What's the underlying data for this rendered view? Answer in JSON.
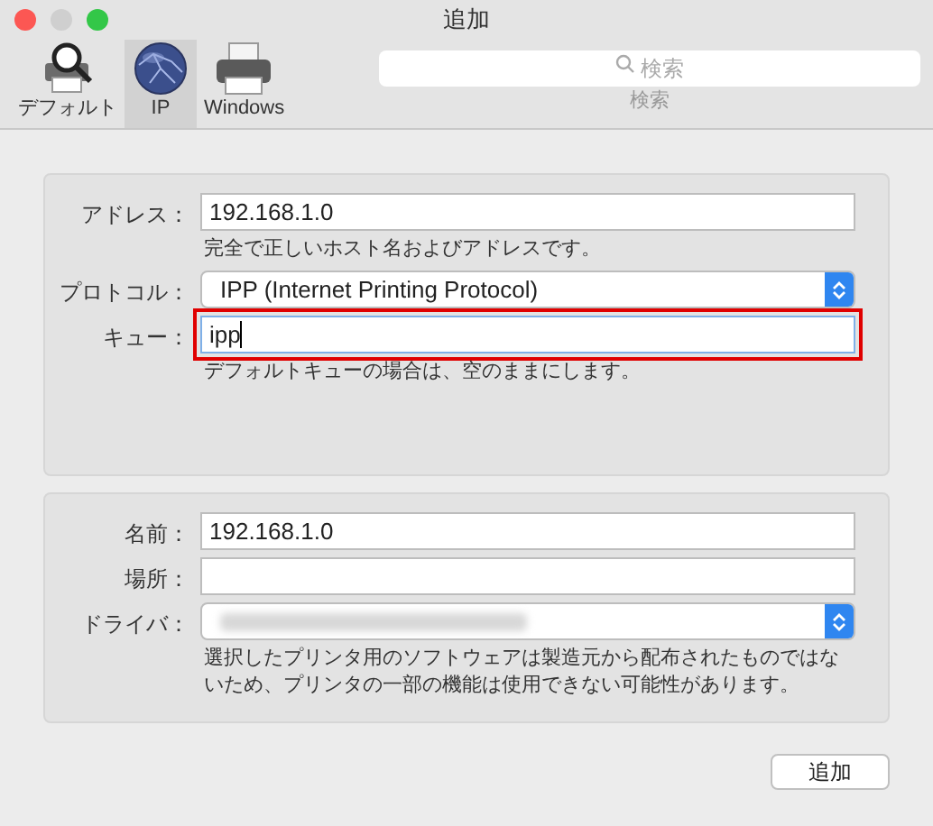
{
  "window": {
    "title": "追加"
  },
  "toolbar": [
    {
      "label": "デフォルト",
      "kind": "search-printer",
      "selected": false
    },
    {
      "label": "IP",
      "kind": "globe",
      "selected": true
    },
    {
      "label": "Windows",
      "kind": "printer",
      "selected": false
    }
  ],
  "search": {
    "placeholder": "検索",
    "caption": "検索"
  },
  "sections": [
    {
      "fields": [
        {
          "label": "アドレス：",
          "kind": "text",
          "value": "192.168.1.0",
          "hint": "完全で正しいホスト名およびアドレスです。",
          "highlighted": false
        },
        {
          "label": "プロトコル：",
          "kind": "popup",
          "value": "IPP (Internet Printing Protocol)",
          "highlighted": false
        },
        {
          "label": "キュー：",
          "kind": "text",
          "value": "ipp",
          "hint": "デフォルトキューの場合は、空のままにします。",
          "highlighted": true
        }
      ]
    },
    {
      "fields": [
        {
          "label": "名前：",
          "kind": "text",
          "value": "192.168.1.0",
          "highlighted": false
        },
        {
          "label": "場所：",
          "kind": "text",
          "highlighted": false
        },
        {
          "label": "ドライバ：",
          "kind": "popup",
          "obscured": true,
          "hint": "選択したプリンタ用のソフトウェアは製造元から配布されたものではないため、プリンタの一部の機能は使用できない可能性があります。",
          "highlighted": false
        }
      ]
    }
  ],
  "buttons": [
    {
      "label": "追加"
    }
  ]
}
